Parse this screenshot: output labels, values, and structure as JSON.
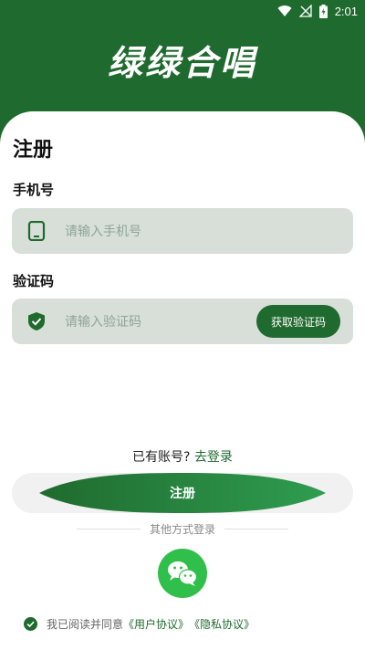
{
  "status_bar": {
    "time": "2:01"
  },
  "app": {
    "title": "绿绿合唱"
  },
  "page": {
    "title": "注册"
  },
  "phone": {
    "label": "手机号",
    "placeholder": "请输入手机号"
  },
  "code": {
    "label": "验证码",
    "placeholder": "请输入验证码",
    "button_label": "获取验证码"
  },
  "login_prompt": {
    "text": "已有账号?",
    "link": "去登录"
  },
  "register": {
    "label": "注册"
  },
  "other_login": {
    "text": "其他方式登录"
  },
  "agreement": {
    "prefix": "我已阅读并同意",
    "user_agreement": "《用户协议》",
    "privacy_agreement": "《隐私协议》"
  },
  "colors": {
    "brand": "#1f6a2e",
    "input_bg": "#d7dfd8",
    "wechat": "#2fbf4a"
  }
}
